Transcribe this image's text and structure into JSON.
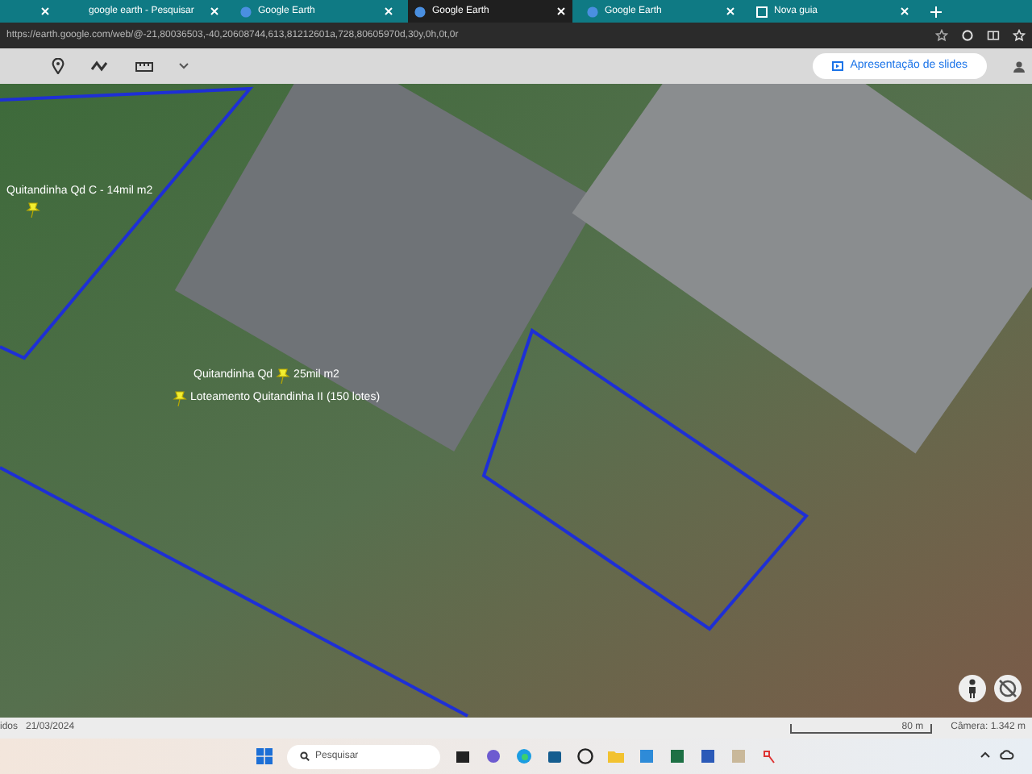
{
  "browser": {
    "tabs": [
      {
        "selected": false
      },
      {
        "title": "google earth - Pesquisar",
        "selected": false,
        "kind": "search"
      },
      {
        "title": "Google Earth",
        "selected": false,
        "kind": "earth"
      },
      {
        "title": "Google Earth",
        "selected": true,
        "kind": "earth"
      },
      {
        "title": "Google Earth",
        "selected": false,
        "kind": "earth"
      },
      {
        "title": "Nova guia",
        "selected": false,
        "kind": "newtab"
      }
    ],
    "address": "https://earth.google.com/web/@-21,80036503,-40,20608744,613,81212601a,728,80605970d,30y,0h,0t,0r"
  },
  "toolbar": {
    "slideshow_button": "Apresentação de slides"
  },
  "map": {
    "labels": [
      {
        "text": "Quitandinha Qd C - 14mil m2",
        "kind": "above"
      },
      {
        "text": "Quitandinha Qd",
        "kind": "split",
        "after": "25mil m2"
      },
      {
        "text": "Loteamento Quitandinha II (150 lotes)",
        "kind": "pinleft"
      }
    ]
  },
  "status_bar": {
    "left": "idos",
    "date": "21/03/2024",
    "scale": "80 m",
    "camera": "Câmera: 1.342 m"
  },
  "taskbar": {
    "search_placeholder": "Pesquisar"
  }
}
